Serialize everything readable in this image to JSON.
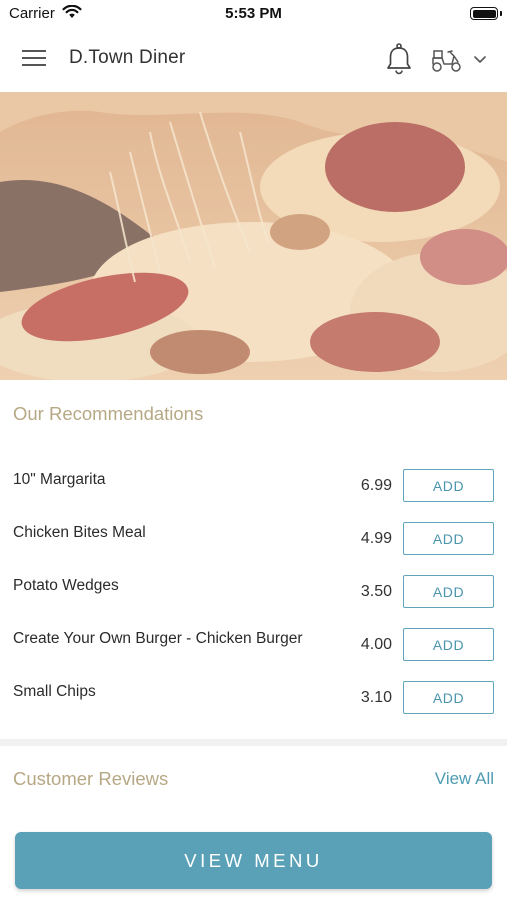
{
  "status_bar": {
    "carrier": "Carrier",
    "time": "5:53 PM"
  },
  "header": {
    "title": "D.Town Diner",
    "icons": [
      "hamburger-menu-icon",
      "bell-icon",
      "scooter-icon",
      "chevron-down-icon"
    ]
  },
  "hero": {
    "image": "pizza-photo"
  },
  "recommendations": {
    "title": "Our Recommendations",
    "add_label": "ADD",
    "items": [
      {
        "name": "10\" Margarita",
        "price": "6.99"
      },
      {
        "name": "Chicken Bites Meal",
        "price": "4.99"
      },
      {
        "name": "Potato Wedges",
        "price": "3.50"
      },
      {
        "name": "Create Your Own Burger - Chicken Burger",
        "price": "4.00"
      },
      {
        "name": "Small Chips",
        "price": "3.10"
      }
    ]
  },
  "reviews": {
    "title": "Customer Reviews",
    "view_all": "View All"
  },
  "footer": {
    "view_menu": "VIEW MENU"
  },
  "colors": {
    "accent": "#5aa1b7",
    "section_title": "#b7a885",
    "add_button_border": "#5fa5bb"
  }
}
